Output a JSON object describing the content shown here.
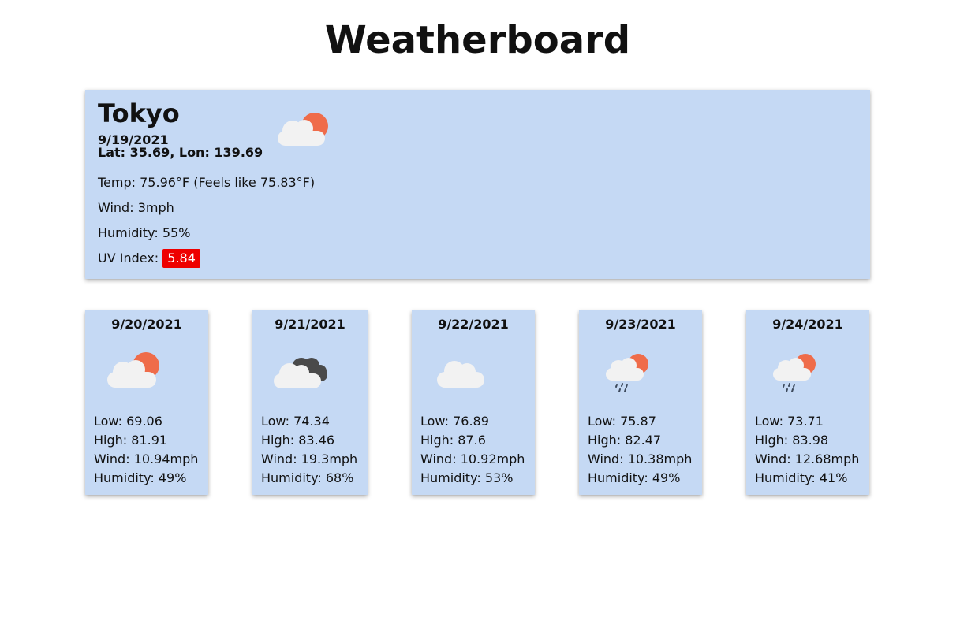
{
  "app": {
    "title": "Weatherboard"
  },
  "current": {
    "city": "Tokyo",
    "date": "9/19/2021",
    "coords": "Lat: 35.69, Lon: 139.69",
    "icon": "cloud-sun-icon",
    "temp": "Temp: 75.96°F (Feels like 75.83°F)",
    "wind": "Wind: 3mph",
    "humidity": "Humidity: 55%",
    "uv_label": "UV Index:",
    "uv_value": "5.84",
    "uv_color": "#ee0000"
  },
  "forecast": [
    {
      "date": "9/20/2021",
      "icon": "cloud-sun-icon",
      "low": "Low: 69.06",
      "high": "High: 81.91",
      "wind": "Wind: 10.94mph",
      "humidity": "Humidity: 49%"
    },
    {
      "date": "9/21/2021",
      "icon": "dark-clouds-icon",
      "low": "Low: 74.34",
      "high": "High: 83.46",
      "wind": "Wind: 19.3mph",
      "humidity": "Humidity: 68%"
    },
    {
      "date": "9/22/2021",
      "icon": "cloud-icon",
      "low": "Low: 76.89",
      "high": "High: 87.6",
      "wind": "Wind: 10.92mph",
      "humidity": "Humidity: 53%"
    },
    {
      "date": "9/23/2021",
      "icon": "rain-sun-icon",
      "low": "Low: 75.87",
      "high": "High: 82.47",
      "wind": "Wind: 10.38mph",
      "humidity": "Humidity: 49%"
    },
    {
      "date": "9/24/2021",
      "icon": "rain-sun-icon",
      "low": "Low: 73.71",
      "high": "High: 83.98",
      "wind": "Wind: 12.68mph",
      "humidity": "Humidity: 41%"
    }
  ],
  "colors": {
    "card_bg": "#c5d9f4",
    "sun": "#ef6c4a",
    "cloud": "#f2f2f2",
    "dark_cloud": "#4a4a4a",
    "rain": "#3d4a5c"
  }
}
